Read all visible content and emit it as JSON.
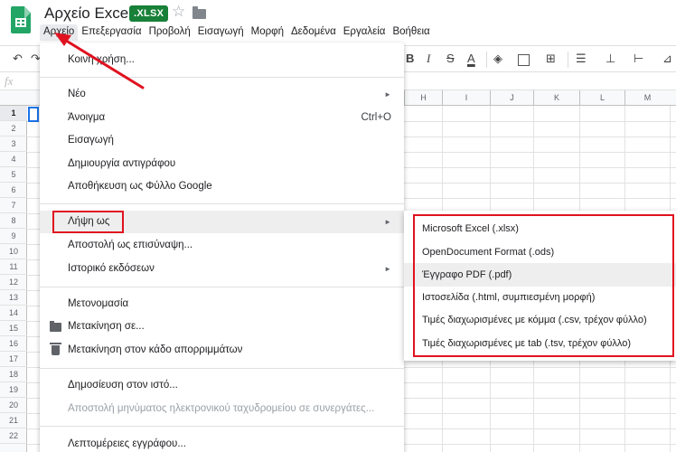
{
  "header": {
    "doc_title": "Αρχείο Excel",
    "badge": ".XLSX",
    "star_icon": "☆",
    "folder_icon": "folder-icon"
  },
  "menubar": [
    {
      "label": "Αρχείο",
      "active": true
    },
    {
      "label": "Επεξεργασία"
    },
    {
      "label": "Προβολή"
    },
    {
      "label": "Εισαγωγή"
    },
    {
      "label": "Μορφή"
    },
    {
      "label": "Δεδομένα"
    },
    {
      "label": "Εργαλεία"
    },
    {
      "label": "Βοήθεια"
    }
  ],
  "toolbar": {
    "undo": "↶",
    "redo": "↷",
    "bold": "B",
    "italic": "I",
    "strike": "S",
    "text_color": "A",
    "fill": "◈",
    "merge": "⊞",
    "halign": "☰",
    "valign": "⊥",
    "wrap": "⊢",
    "rotate": "⊿"
  },
  "formula_bar": {
    "fx": "fx"
  },
  "grid": {
    "columns": [
      "H",
      "I",
      "J",
      "K",
      "L",
      "M"
    ],
    "rows": [
      "1",
      "2",
      "3",
      "4",
      "5",
      "6",
      "7",
      "8",
      "9",
      "10",
      "11",
      "12",
      "13",
      "14",
      "15",
      "16",
      "17",
      "18",
      "19",
      "20",
      "21",
      "22"
    ]
  },
  "file_menu": {
    "items": [
      {
        "label": "Κοινή χρήση..."
      },
      {
        "label": "Νέο",
        "submenu": true
      },
      {
        "label": "Άνοιγμα",
        "shortcut": "Ctrl+O"
      },
      {
        "label": "Εισαγωγή"
      },
      {
        "label": "Δημιουργία αντιγράφου"
      },
      {
        "label": "Αποθήκευση ως Φύλλο Google"
      },
      {
        "label": "Λήψη ως",
        "submenu": true,
        "highlighted": true
      },
      {
        "label": "Αποστολή ως επισύναψη..."
      },
      {
        "label": "Ιστορικό εκδόσεων",
        "submenu": true
      },
      {
        "label": "Μετονομασία"
      },
      {
        "label": "Μετακίνηση σε..."
      },
      {
        "label": "Μετακίνηση στον κάδο απορριμμάτων"
      },
      {
        "label": "Δημοσίευση στον ιστό..."
      },
      {
        "label": "Αποστολή μηνύματος ηλεκτρονικού ταχυδρομείου σε συνεργάτες...",
        "disabled": true
      },
      {
        "label": "Λεπτομέρειες εγγράφου..."
      }
    ],
    "submenu_arrow": "►"
  },
  "download_submenu": {
    "items": [
      {
        "label": "Microsoft Excel (.xlsx)"
      },
      {
        "label": "OpenDocument Format (.ods)"
      },
      {
        "label": "Έγγραφο PDF (.pdf)",
        "highlighted": true
      },
      {
        "label": "Ιστοσελίδα (.html, συμπιεσμένη μορφή)"
      },
      {
        "label": "Τιμές διαχωρισμένες με κόμμα (.csv, τρέχον φύλλο)"
      },
      {
        "label": "Τιμές διαχωρισμένες με tab (.tsv, τρέχον φύλλο)"
      }
    ]
  },
  "colors": {
    "brand_green": "#23a566",
    "badge_green": "#188038",
    "annotation_red": "#e0121f",
    "selection_blue": "#1a73e8"
  }
}
